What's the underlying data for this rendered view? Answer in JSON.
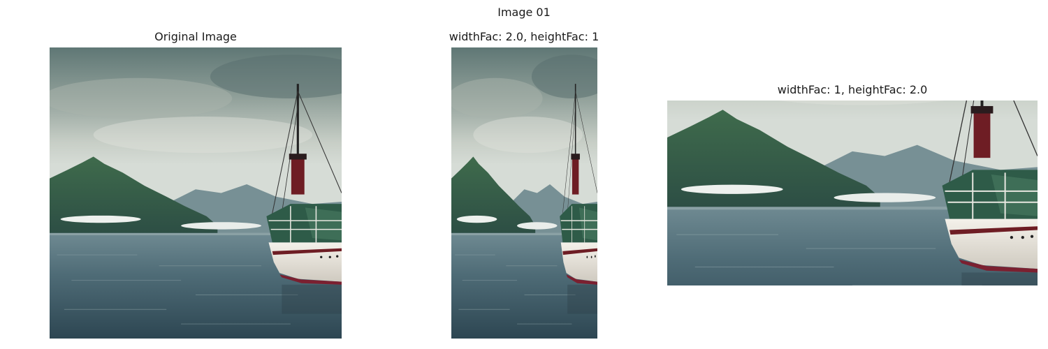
{
  "figure": {
    "suptitle": "Image 01"
  },
  "panels": [
    {
      "title": "Original Image"
    },
    {
      "title": "widthFac: 2.0, heightFac: 1"
    },
    {
      "title": "widthFac: 1, heightFac: 2.0"
    }
  ]
}
